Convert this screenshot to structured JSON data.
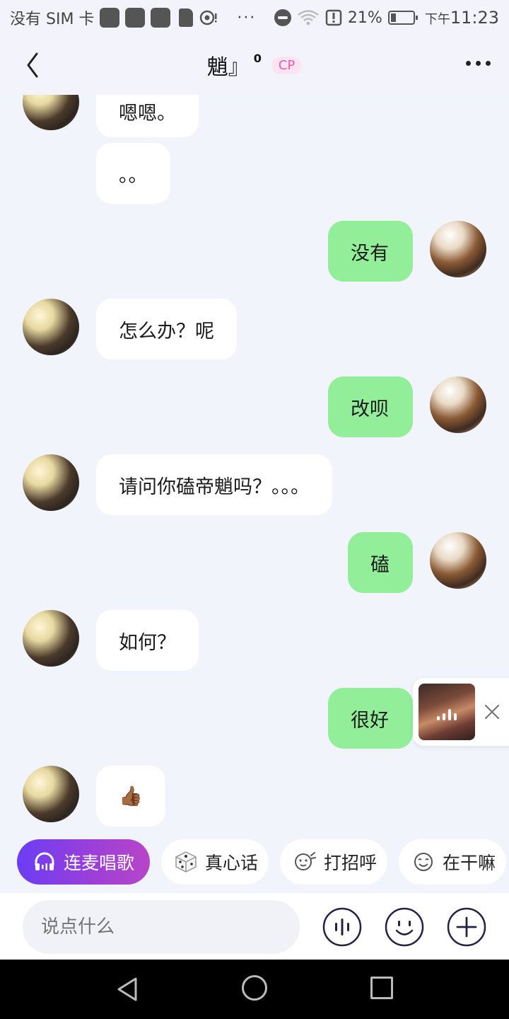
{
  "status_bar": {
    "carrier": "没有 SIM 卡",
    "dots": "···",
    "battery": "21%",
    "time_prefix": "下午",
    "time": "11:23"
  },
  "header": {
    "title": "魈』",
    "superscript": "0",
    "badge": "CP"
  },
  "messages": [
    {
      "from": "other",
      "text": "嗯嗯。"
    },
    {
      "from": "other",
      "text": "。。"
    },
    {
      "from": "self",
      "text": "没有"
    },
    {
      "from": "other",
      "text": "怎么办？呢"
    },
    {
      "from": "self",
      "text": "改呗"
    },
    {
      "from": "other",
      "text": "请问你磕帝魈吗？。。。"
    },
    {
      "from": "self",
      "text": "磕"
    },
    {
      "from": "other",
      "text": "如何？"
    },
    {
      "from": "self",
      "text": "很好"
    },
    {
      "from": "other",
      "text": "👍🏾"
    }
  ],
  "quick_actions": [
    {
      "label": "连麦唱歌",
      "icon": "headphones-icon"
    },
    {
      "label": "真心话",
      "icon": "dice-icon"
    },
    {
      "label": "打招呼",
      "icon": "wave-face-icon"
    },
    {
      "label": "在干嘛",
      "icon": "smile-face-icon"
    }
  ],
  "input": {
    "placeholder": "说点什么"
  },
  "colors": {
    "background": "#f2f4fc",
    "bubble_in": "#ffffff",
    "bubble_out": "#92ee98",
    "badge_bg": "#fde4f3",
    "badge_text": "#f05aa8",
    "primary_gradient_start": "#6b3df5",
    "primary_gradient_end": "#b745c9"
  }
}
